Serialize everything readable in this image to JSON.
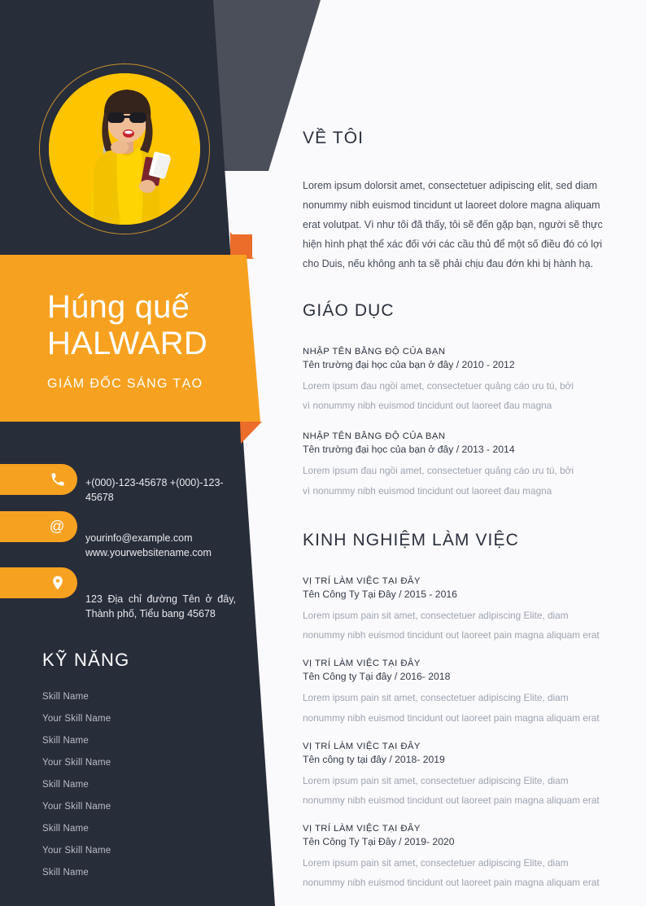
{
  "theme": {
    "navy": "#282D3A",
    "gray_wedge": "#4A4F59",
    "orange": "#F7A120",
    "orange_fold": "#EC6C2A",
    "page_bg": "#FAFAFC",
    "photo_bg": "#FFC400",
    "ring_gold": "#C9922B"
  },
  "profile": {
    "photo_alt": "woman-traveler-photo",
    "name_first": "Húng quế",
    "name_last": "HALWARD",
    "job_title": "GIÁM ĐỐC SÁNG TẠO"
  },
  "contact": {
    "items": [
      {
        "icon": "phone-icon",
        "text": "+(000)-123-45678    +(000)-123-45678"
      },
      {
        "icon": "email-icon",
        "text": "yourinfo@example.com www.yourwebsitename.com"
      },
      {
        "icon": "location-pin-icon",
        "text": "123 Địa chỉ đường Tên ở đây, Thành phố, Tiểu bang 45678"
      }
    ]
  },
  "skills": {
    "title": "KỸ NĂNG",
    "items": [
      "Skill Name",
      "Your Skill Name",
      "Skill Name",
      "Your Skill Name",
      "Skill Name",
      "Your Skill Name",
      "Skill Name",
      "Your Skill Name",
      "Skill Name"
    ]
  },
  "about": {
    "title": "VỀ TÔI",
    "body": "Lorem ipsum dolorsit amet, consectetuer adipiscing elit, sed diam nonummy nibh euismod tincidunt ut laoreet dolore magna aliquam erat volutpat. Vì như tôi đã thấy, tôi sẽ đến gặp bạn, người sẽ thực hiện hình phạt thể xác đối với các cầu thủ để một số điều đó có lợi cho Duis, nếu không anh ta sẽ phải chịu đau đớn khi bị hành hạ."
  },
  "education": {
    "title": "GIÁO DỤC",
    "entries": [
      {
        "degree": "NHẬP TÊN BẰNG ĐỘ CỦA BẠN",
        "school": "Tên trường đại học của bạn ở đây / 2010 - 2012",
        "desc_line1": "Lorem ipsum đau ngồi amet, consectetuer quảng cáo ưu tú, bởi",
        "desc_line2": "vì nonummy nibh euismod tincidunt out laoreet đau magna"
      },
      {
        "degree": "NHẬP TÊN BẰNG ĐỘ CỦA BẠN",
        "school": "Tên trường đại học của bạn ở đây / 2013 - 2014",
        "desc_line1": "Lorem ipsum đau ngồi amet, consectetuer quảng cáo ưu tú, bởi",
        "desc_line2": "vì nonummy nibh euismod tincidunt out laoreet đau magna"
      }
    ]
  },
  "experience": {
    "title": "KINH NGHIỆM LÀM VIỆC",
    "entries": [
      {
        "position": "VỊ TRÍ LÀM VIỆC TẠI ĐÂY",
        "company": "Tên Công Ty Tại Đây / 2015 - 2016",
        "desc_line1": "Lorem ipsum pain sit amet, consectetuer adipiscing Elite, diam",
        "desc_line2": "nonummy nibh euismod tincidunt out laoreet pain magna aliquam erat"
      },
      {
        "position": "VỊ TRÍ LÀM VIỆC TẠI ĐÂY",
        "company": "Tên Công ty Tại đây / 2016- 2018",
        "desc_line1": "Lorem ipsum pain sit amet, consectetuer adipiscing Elite, diam",
        "desc_line2": "nonummy nibh euismod tincidunt out laoreet pain magna aliquam erat"
      },
      {
        "position": "VỊ TRÍ LÀM VIỆC TẠI ĐÂY",
        "company": "Tên công ty tại đây / 2018- 2019",
        "desc_line1": "Lorem ipsum pain sit amet, consectetuer adipiscing Elite, diam",
        "desc_line2": "nonummy nibh euismod tincidunt out laoreet pain magna aliquam erat"
      },
      {
        "position": "VỊ TRÍ LÀM VIỆC TẠI ĐÂY",
        "company": "Tên Công Ty Tại Đây / 2019- 2020",
        "desc_line1": "Lorem ipsum pain sit amet, consectetuer adipiscing Elite, diam",
        "desc_line2": "nonummy nibh euismod tincidunt out laoreet pain magna aliquam erat"
      }
    ]
  }
}
